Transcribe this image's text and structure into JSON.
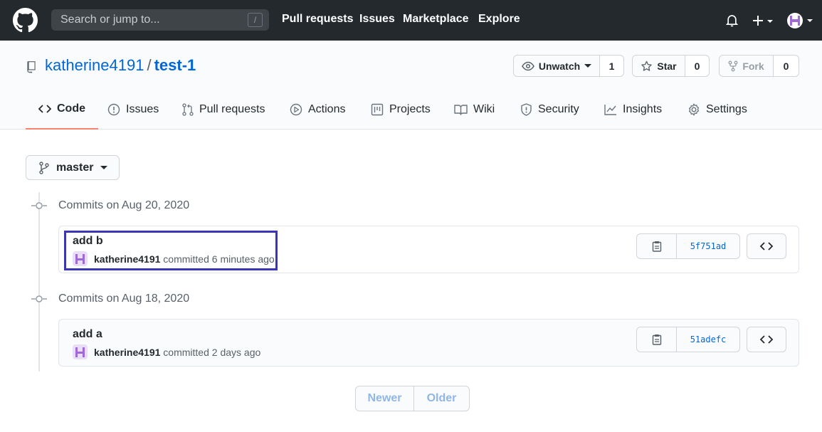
{
  "header": {
    "search_placeholder": "Search or jump to...",
    "search_shortcut": "/",
    "nav": [
      "Pull requests",
      "Issues",
      "Marketplace",
      "Explore"
    ],
    "plus_label": "+"
  },
  "repo": {
    "owner": "katherine4191",
    "separator": "/",
    "name": "test-1",
    "watch": {
      "label": "Unwatch",
      "count": "1"
    },
    "star": {
      "label": "Star",
      "count": "0"
    },
    "fork": {
      "label": "Fork",
      "count": "0"
    }
  },
  "tabs": [
    {
      "label": "Code",
      "icon": "code-icon",
      "selected": true
    },
    {
      "label": "Issues",
      "icon": "issue-icon"
    },
    {
      "label": "Pull requests",
      "icon": "pull-request-icon"
    },
    {
      "label": "Actions",
      "icon": "play-icon"
    },
    {
      "label": "Projects",
      "icon": "project-icon"
    },
    {
      "label": "Wiki",
      "icon": "book-icon"
    },
    {
      "label": "Security",
      "icon": "shield-icon"
    },
    {
      "label": "Insights",
      "icon": "graph-icon"
    },
    {
      "label": "Settings",
      "icon": "gear-icon"
    }
  ],
  "branch": {
    "name": "master"
  },
  "commit_groups": [
    {
      "date_label": "Commits on Aug 20, 2020",
      "commits": [
        {
          "title": "add b",
          "author": "katherine4191",
          "action": "committed",
          "time": "6 minutes ago",
          "sha": "5f751ad"
        }
      ]
    },
    {
      "date_label": "Commits on Aug 18, 2020",
      "commits": [
        {
          "title": "add a",
          "author": "katherine4191",
          "action": "committed",
          "time": "2 days ago",
          "sha": "51adefc"
        }
      ]
    }
  ],
  "pagination": {
    "newer": "Newer",
    "older": "Older"
  },
  "colors": {
    "header_bg": "#24292e",
    "link": "#0366d6",
    "selected_tab_underline": "#f9826c",
    "highlight_border": "#3b36b5"
  }
}
